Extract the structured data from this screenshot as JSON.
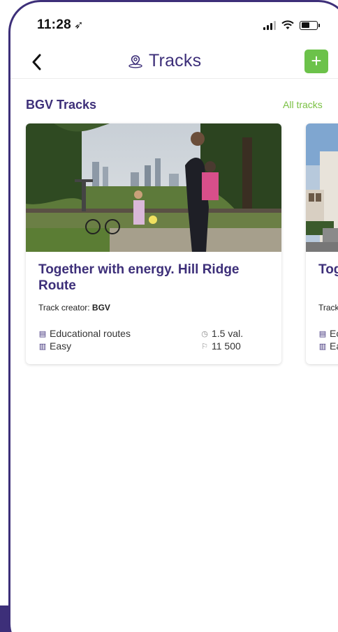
{
  "status_bar": {
    "time": "11:28",
    "location_arrow": "➶"
  },
  "nav": {
    "back": "❮",
    "title": "Tracks",
    "add": "+"
  },
  "section": {
    "title": "BGV Tracks",
    "all_tracks": "All tracks"
  },
  "cards": [
    {
      "title": "Together with energy. Hill Ridge Route",
      "creator_label": "Track creator:",
      "creator": "BGV",
      "category": "Educational routes",
      "difficulty": "Easy",
      "duration": "1.5 val.",
      "steps": "11 500"
    },
    {
      "title": "Tog",
      "creator_label": "Track",
      "category": "Ec",
      "difficulty": "Ea"
    }
  ],
  "colors": {
    "brand": "#3d2f79",
    "accent_green": "#6cc24a",
    "link_green": "#7ac143"
  }
}
